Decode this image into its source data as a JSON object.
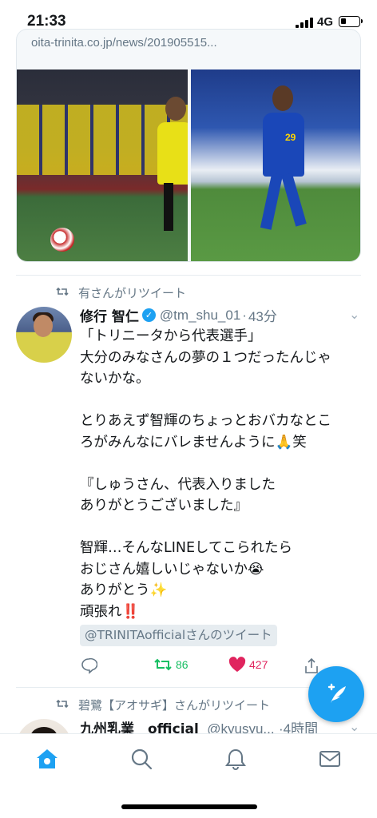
{
  "status_bar": {
    "time": "21:33",
    "network": "4G",
    "battery_percent": 30
  },
  "link_card": {
    "url_text": "oita-trinita.co.jp/news/201905515..."
  },
  "tweet": {
    "retweeted_by": "有さんがリツイート",
    "display_name": "修行 智仁",
    "verified": true,
    "handle": "@tm_shu_01",
    "time": "43分",
    "body_lines": [
      "「トリニータから代表選手」",
      "大分のみなさんの夢の１つだったんじゃ",
      "ないかな。",
      "",
      "とりあえず智輝のちょっとおバカなとこ",
      "ろがみんなにバレませんように🙏笑",
      "",
      "『しゅうさん、代表入りました",
      "ありがとうございました』",
      "",
      "智輝…そんなLINEしてこられたら",
      "おじさん嬉しいじゃないか😭",
      "ありがとう✨",
      "頑張れ‼️"
    ],
    "quoted_chip": "@TRINITAofficialさんのツイート",
    "retweet_count": "86",
    "like_count": "427"
  },
  "next_tweet": {
    "retweeted_by": "碧鷺【アオサギ】さんがリツイート",
    "display_name": "九州乳業　official",
    "handle": "@kyusyu...",
    "time": "·4時間"
  },
  "colors": {
    "accent": "#1da1f2",
    "retweet_green": "#17bf63",
    "like_red": "#e0245e",
    "secondary_text": "#657786"
  },
  "icons": {
    "retweet": "retweet-icon",
    "reply": "reply-icon",
    "like": "heart-icon",
    "share": "share-icon",
    "compose": "compose-icon",
    "home": "home-icon",
    "search": "search-icon",
    "notifications": "bell-icon",
    "messages": "mail-icon"
  }
}
